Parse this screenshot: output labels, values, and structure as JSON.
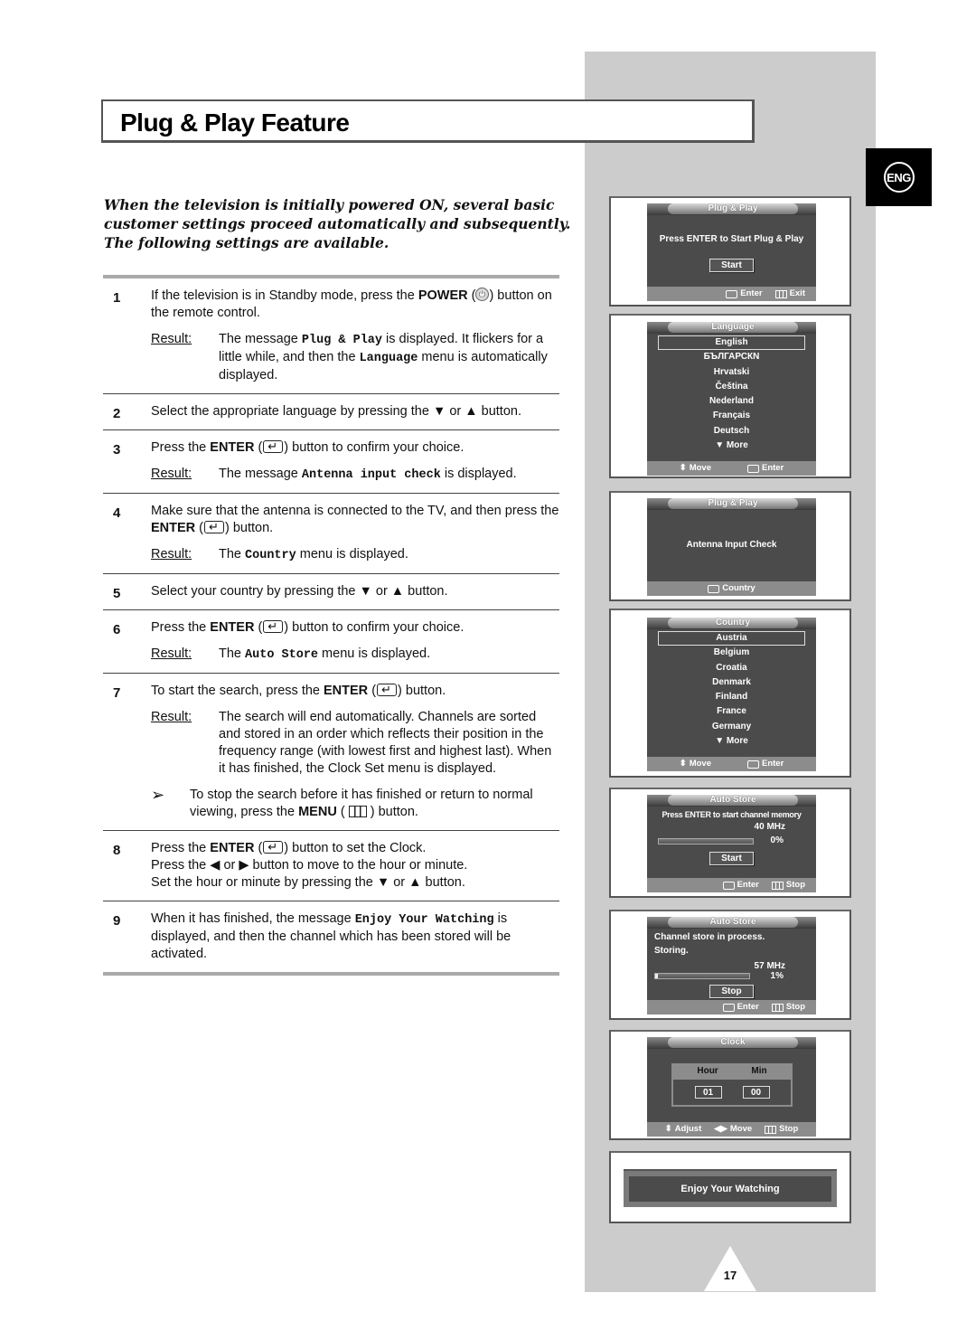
{
  "page": {
    "title": "Plug & Play Feature",
    "language_badge": "ENG",
    "page_number": "17",
    "intro": "When the television is initially powered ON, several basic customer settings proceed automatically and subsequently. The following settings are available."
  },
  "steps": [
    {
      "num": "1",
      "text_a": "If the television is in Standby mode, press the ",
      "bold": "POWER",
      "text_b": ") button on the remote control.",
      "icon": "power-icon",
      "result_label": "Result:",
      "result_a": "The message ",
      "result_code1": "Plug & Play",
      "result_b": " is displayed. It flickers for a little while, and then the ",
      "result_code2": "Language",
      "result_c": " menu is automatically displayed."
    },
    {
      "num": "2",
      "text": "Select the appropriate language by pressing the ▼ or ▲ button."
    },
    {
      "num": "3",
      "text_a": "Press the ",
      "bold": "ENTER",
      "text_b": ") button to confirm your choice.",
      "icon": "enter-icon",
      "result_label": "Result:",
      "result_a": "The message ",
      "result_code": "Antenna input check",
      "result_b": " is displayed."
    },
    {
      "num": "4",
      "text_a": "Make sure that the antenna is connected to the TV, and then press the ",
      "bold": "ENTER",
      "text_b": ") button.",
      "icon": "enter-icon",
      "result_label": "Result:",
      "result_a": "The ",
      "result_code": "Country",
      "result_b": " menu is displayed."
    },
    {
      "num": "5",
      "text": "Select your country by pressing the ▼ or ▲ button."
    },
    {
      "num": "6",
      "text_a": "Press the ",
      "bold": "ENTER",
      "text_b": ") button to confirm your choice.",
      "icon": "enter-icon",
      "result_label": "Result:",
      "result_a": "The ",
      "result_code": "Auto Store",
      "result_b": " menu is displayed."
    },
    {
      "num": "7",
      "text_a": "To start the search, press the ",
      "bold": "ENTER",
      "text_b": ") button.",
      "icon": "enter-icon",
      "result_label": "Result:",
      "result_text": "The search will end automatically. Channels are sorted and stored in an order which reflects their position in the frequency range (with lowest first and highest last). When it has finished, the Clock Set menu is displayed.",
      "note_arrow": "➢",
      "note_a": "To stop the search before it has finished or return to normal viewing, press the ",
      "note_bold": "MENU",
      "note_b": " ) button."
    },
    {
      "num": "8",
      "text_a": "Press the ",
      "bold": "ENTER",
      "text_b": ") button to set the Clock.",
      "icon": "enter-icon",
      "line2": "Press the ◀ or ▶ button to move to the hour or minute.",
      "line3": "Set the hour or minute by pressing the ▼ or ▲ button."
    },
    {
      "num": "9",
      "text_a": "When it has finished, the message ",
      "code": "Enjoy Your Watching",
      "text_b": " is displayed, and then the channel which has been stored will be activated."
    }
  ],
  "screens": {
    "plug_play_start": {
      "title": "Plug & Play",
      "message": "Press ENTER to Start Plug & Play",
      "button": "Start",
      "foot_enter": "Enter",
      "foot_exit": "Exit"
    },
    "language": {
      "title": "Language",
      "items": [
        "English",
        "БЪЛГАРСКN",
        "Hrvatski",
        "Čeština",
        "Nederland",
        "Français",
        "Deutsch",
        "▼ More"
      ],
      "selected": "English",
      "foot_move": "Move",
      "foot_enter": "Enter"
    },
    "antenna": {
      "title": "Plug & Play",
      "message": "Antenna Input Check",
      "foot_country": "Country"
    },
    "country": {
      "title": "Country",
      "items": [
        "Austria",
        "Belgium",
        "Croatia",
        "Denmark",
        "Finland",
        "France",
        "Germany",
        "▼ More"
      ],
      "selected": "Austria",
      "foot_move": "Move",
      "foot_enter": "Enter"
    },
    "auto_store_start": {
      "title": "Auto Store",
      "message": "Press ENTER to start channel memory",
      "freq": "40 MHz",
      "percent": "0%",
      "progress": 0,
      "button": "Start",
      "foot_enter": "Enter",
      "foot_stop": "Stop"
    },
    "auto_store_progress": {
      "title": "Auto Store",
      "line1": "Channel store in process.",
      "line2": "Storing.",
      "freq": "57 MHz",
      "percent": "1%",
      "progress": 0.01,
      "button": "Stop",
      "foot_enter": "Enter",
      "foot_stop": "Stop"
    },
    "clock": {
      "title": "Clock",
      "hour_label": "Hour",
      "min_label": "Min",
      "hour": "01",
      "min": "00",
      "foot_adjust": "Adjust",
      "foot_move": "Move",
      "foot_stop": "Stop"
    },
    "enjoy": {
      "message": "Enjoy Your Watching"
    }
  }
}
